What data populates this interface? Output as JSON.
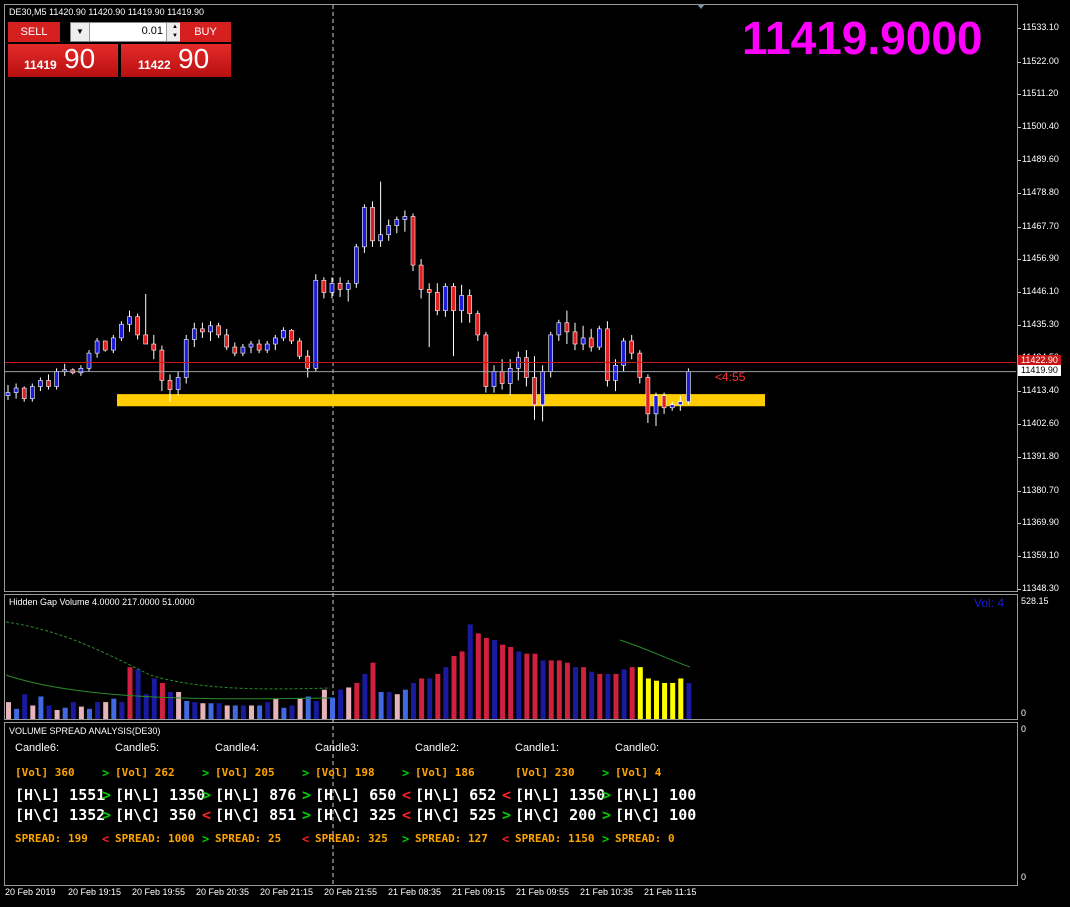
{
  "symbol_info": "DE30,M5  11420.90 11420.90 11419.90 11419.90",
  "big_price": "11419.9000",
  "countdown": "<4:55",
  "trade_panel": {
    "sell_label": "SELL",
    "buy_label": "BUY",
    "lot": "0.01",
    "sell_price_small": "11419",
    "sell_price_big": "90",
    "buy_price_small": "11422",
    "buy_price_big": "90"
  },
  "price_axis": {
    "ticks": [
      "11533.10",
      "11522.00",
      "11511.20",
      "11500.40",
      "11489.60",
      "11478.80",
      "11467.70",
      "11456.90",
      "11446.10",
      "11435.30",
      "11424.50",
      "11413.40",
      "11402.60",
      "11391.80",
      "11380.70",
      "11369.90",
      "11359.10",
      "11348.30"
    ],
    "current_price_label": "11419.90",
    "ask_price_label": "11422.90"
  },
  "volume_pane": {
    "title": "Hidden Gap Volume 4.0000 217.0000 51.0000",
    "vol_label": "Vol: 4",
    "axis_top": "528.15",
    "axis_bottom": "0"
  },
  "vsa_pane": {
    "title": "VOLUME SPREAD ANALYSIS(DE30)",
    "axis_top": "0",
    "axis_bottom": "0",
    "candles": [
      {
        "header": "Candle6:",
        "vol": "[Vol] 360",
        "hl": "[H\\L] 1551",
        "hc": "[H\\C] 1352",
        "spread": "SPREAD: 199"
      },
      {
        "header": "Candle5:",
        "vol": "[Vol] 262",
        "hl": "[H\\L] 1350",
        "hc": "[H\\C] 350",
        "spread": "SPREAD: 1000"
      },
      {
        "header": "Candle4:",
        "vol": "[Vol] 205",
        "hl": "[H\\L] 876",
        "hc": "[H\\C] 851",
        "spread": "SPREAD: 25"
      },
      {
        "header": "Candle3:",
        "vol": "[Vol] 198",
        "hl": "[H\\L] 650",
        "hc": "[H\\C] 325",
        "spread": "SPREAD: 325"
      },
      {
        "header": "Candle2:",
        "vol": "[Vol] 186",
        "hl": "[H\\L] 652",
        "hc": "[H\\C] 525",
        "spread": "SPREAD: 127"
      },
      {
        "header": "Candle1:",
        "vol": "[Vol] 230",
        "hl": "[H\\L] 1350",
        "hc": "[H\\C] 200",
        "spread": "SPREAD: 1150"
      },
      {
        "header": "Candle0:",
        "vol": "[Vol] 4",
        "hl": "[H\\L] 100",
        "hc": "[H\\C] 100",
        "spread": "SPREAD: 0"
      }
    ],
    "arrows": {
      "vol": [
        "",
        ">",
        ">",
        ">",
        ">",
        "",
        ">"
      ],
      "hl": [
        "",
        ">",
        ">",
        ">",
        "<",
        "<",
        ">"
      ],
      "hc": [
        "",
        ">",
        "<",
        ">",
        "<",
        ">",
        ">"
      ],
      "spread": [
        "",
        "<",
        ">",
        "<",
        ">",
        "<",
        ">"
      ]
    }
  },
  "time_axis": [
    "20 Feb 2019",
    "20 Feb 19:15",
    "20 Feb 19:55",
    "20 Feb 20:35",
    "20 Feb 21:15",
    "20 Feb 21:55",
    "21 Feb 08:35",
    "21 Feb 09:15",
    "21 Feb 09:55",
    "21 Feb 10:35",
    "21 Feb 11:15"
  ],
  "colors": {
    "bull": "#1c1cd8",
    "bear": "#e02020",
    "zone": "#ffcc00",
    "big_price": "#ff00ff",
    "ask_line": "#c81414",
    "bid_line": "#9aa0a8"
  },
  "chart_data": [
    {
      "type": "candlestick",
      "title": "DE30,M5",
      "ylim": [
        11348.3,
        11540
      ],
      "support_zone": [
        11408.5,
        11412.5
      ],
      "candles": [
        [
          11412.0,
          11415.5,
          11410.5,
          11413.0
        ],
        [
          11413.0,
          11416.0,
          11411.0,
          11414.5
        ],
        [
          11414.5,
          11415.0,
          11410.0,
          11411.0
        ],
        [
          11411.0,
          11416.0,
          11410.0,
          11415.0
        ],
        [
          11415.0,
          11418.0,
          11413.5,
          11417.0
        ],
        [
          11417.0,
          11419.0,
          11414.0,
          11415.0
        ],
        [
          11415.0,
          11421.0,
          11414.0,
          11420.0
        ],
        [
          11420.0,
          11422.5,
          11418.5,
          11420.5
        ],
        [
          11420.5,
          11421.0,
          11419.0,
          11419.5
        ],
        [
          11419.5,
          11422.0,
          11418.5,
          11421.0
        ],
        [
          11421.0,
          11427.0,
          11420.0,
          11426.0
        ],
        [
          11426.0,
          11431.0,
          11424.5,
          11430.0
        ],
        [
          11430.0,
          11430.0,
          11426.5,
          11427.0
        ],
        [
          11427.0,
          11432.0,
          11426.0,
          11431.0
        ],
        [
          11431.0,
          11436.5,
          11430.0,
          11435.5
        ],
        [
          11435.5,
          11440.0,
          11433.0,
          11438.0
        ],
        [
          11438.0,
          11439.0,
          11430.5,
          11432.0
        ],
        [
          11432.0,
          11445.5,
          11430.0,
          11429.0
        ],
        [
          11429.0,
          11432.0,
          11424.0,
          11427.0
        ],
        [
          11427.0,
          11428.5,
          11413.5,
          11417.0
        ],
        [
          11417.0,
          11419.0,
          11410.0,
          11414.0
        ],
        [
          11414.0,
          11420.0,
          11412.0,
          11418.0
        ],
        [
          11418.0,
          11432.0,
          11416.0,
          11430.5
        ],
        [
          11430.5,
          11436.0,
          11428.0,
          11434.0
        ],
        [
          11434.0,
          11436.0,
          11431.0,
          11433.0
        ],
        [
          11433.0,
          11436.5,
          11430.0,
          11435.0
        ],
        [
          11435.0,
          11436.0,
          11431.0,
          11432.0
        ],
        [
          11432.0,
          11434.0,
          11427.0,
          11428.0
        ],
        [
          11428.0,
          11429.5,
          11425.0,
          11426.0
        ],
        [
          11426.0,
          11429.0,
          11425.0,
          11428.0
        ],
        [
          11428.0,
          11430.0,
          11426.0,
          11429.0
        ],
        [
          11429.0,
          11430.5,
          11426.0,
          11427.0
        ],
        [
          11427.0,
          11430.0,
          11426.0,
          11429.0
        ],
        [
          11429.0,
          11432.0,
          11427.0,
          11431.0
        ],
        [
          11431.0,
          11434.5,
          11430.0,
          11433.5
        ],
        [
          11433.5,
          11434.0,
          11429.0,
          11430.0
        ],
        [
          11430.0,
          11431.0,
          11424.0,
          11425.0
        ],
        [
          11425.0,
          11427.0,
          11418.0,
          11421.0
        ],
        [
          11421.0,
          11452.0,
          11420.0,
          11450.0
        ],
        [
          11450.0,
          11451.0,
          11444.0,
          11446.0
        ],
        [
          11446.0,
          11451.0,
          11444.0,
          11449.0
        ],
        [
          11449.0,
          11451.0,
          11444.5,
          11447.0
        ],
        [
          11447.0,
          11450.0,
          11443.0,
          11449.0
        ],
        [
          11449.0,
          11462.0,
          11447.5,
          11461.0
        ],
        [
          11461.0,
          11475.0,
          11459.0,
          11474.0
        ],
        [
          11474.0,
          11476.0,
          11461.0,
          11463.0
        ],
        [
          11463.0,
          11482.5,
          11461.0,
          11465.0
        ],
        [
          11465.0,
          11470.0,
          11463.0,
          11468.0
        ],
        [
          11468.0,
          11471.0,
          11465.5,
          11470.0
        ],
        [
          11470.0,
          11473.0,
          11466.0,
          11471.0
        ],
        [
          11471.0,
          11472.0,
          11453.0,
          11455.0
        ],
        [
          11455.0,
          11457.0,
          11444.0,
          11447.0
        ],
        [
          11447.0,
          11449.0,
          11428.0,
          11446.0
        ],
        [
          11446.0,
          11449.0,
          11438.5,
          11440.0
        ],
        [
          11440.0,
          11449.0,
          11438.0,
          11448.0
        ],
        [
          11448.0,
          11449.0,
          11425.0,
          11440.0
        ],
        [
          11440.0,
          11448.5,
          11436.0,
          11445.0
        ],
        [
          11445.0,
          11447.0,
          11436.0,
          11439.0
        ],
        [
          11439.0,
          11440.0,
          11430.0,
          11432.0
        ],
        [
          11432.0,
          11433.0,
          11413.0,
          11415.0
        ],
        [
          11415.0,
          11422.0,
          11413.0,
          11420.0
        ],
        [
          11420.0,
          11424.0,
          11414.0,
          11416.0
        ],
        [
          11416.0,
          11424.0,
          11412.0,
          11421.0
        ],
        [
          11421.0,
          11426.5,
          11417.0,
          11424.5
        ],
        [
          11424.5,
          11427.0,
          11415.0,
          11418.0
        ],
        [
          11418.0,
          11425.0,
          11404.0,
          11409.0
        ],
        [
          11409.0,
          11422.0,
          11403.5,
          11420.0
        ],
        [
          11420.0,
          11433.0,
          11418.0,
          11432.0
        ],
        [
          11432.0,
          11437.0,
          11430.0,
          11436.0
        ],
        [
          11436.0,
          11440.0,
          11429.0,
          11433.0
        ],
        [
          11433.0,
          11436.0,
          11427.0,
          11429.0
        ],
        [
          11429.0,
          11435.0,
          11427.0,
          11431.0
        ],
        [
          11431.0,
          11434.0,
          11426.5,
          11428.0
        ],
        [
          11428.0,
          11435.0,
          11427.0,
          11434.0
        ],
        [
          11434.0,
          11436.5,
          11415.0,
          11417.0
        ],
        [
          11417.0,
          11424.0,
          11413.5,
          11422.0
        ],
        [
          11422.0,
          11431.0,
          11420.0,
          11430.0
        ],
        [
          11430.0,
          11432.0,
          11424.0,
          11426.0
        ],
        [
          11426.0,
          11427.0,
          11416.0,
          11418.0
        ],
        [
          11418.0,
          11419.0,
          11403.0,
          11406.0
        ],
        [
          11406.0,
          11413.0,
          11402.0,
          11412.0
        ],
        [
          11412.0,
          11413.0,
          11406.0,
          11408.0
        ],
        [
          11408.0,
          11410.0,
          11407.0,
          11409.0
        ],
        [
          11409.0,
          11412.0,
          11407.0,
          11410.0
        ],
        [
          11410.0,
          11421.0,
          11409.0,
          11419.9
        ]
      ]
    },
    {
      "type": "bar",
      "title": "Hidden Gap Volume 4.0000 217.0000 51.0000",
      "ylim": [
        0,
        528.15
      ],
      "values": [
        75,
        45,
        110,
        60,
        100,
        60,
        40,
        50,
        75,
        55,
        45,
        75,
        75,
        90,
        75,
        230,
        220,
        110,
        180,
        160,
        120,
        120,
        80,
        75,
        70,
        70,
        70,
        60,
        60,
        60,
        60,
        60,
        75,
        90,
        50,
        60,
        90,
        100,
        80,
        130,
        95,
        130,
        140,
        160,
        200,
        250,
        120,
        120,
        110,
        130,
        160,
        180,
        180,
        200,
        230,
        280,
        300,
        420,
        380,
        360,
        350,
        330,
        320,
        300,
        290,
        290,
        260,
        260,
        260,
        250,
        230,
        230,
        210,
        200,
        200,
        200,
        220,
        230,
        230,
        180,
        170,
        160,
        160,
        180,
        160
      ]
    }
  ]
}
